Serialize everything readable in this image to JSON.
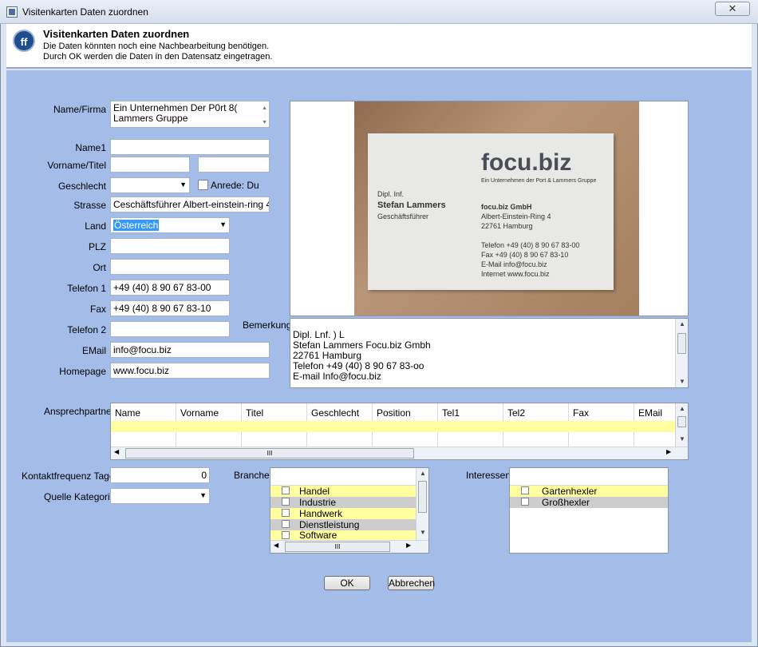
{
  "window": {
    "title": "Visitenkarten Daten zuordnen",
    "close": "✕"
  },
  "header": {
    "title": "Visitenkarten Daten zuordnen",
    "line1": "Die Daten könnten noch eine Nachbearbeitung benötigen.",
    "line2": "Durch OK werden die Daten in den Datensatz eingetragen.",
    "logo": "ff"
  },
  "form": {
    "name_firma_label": "Name/Firma",
    "name_firma_line1": "Ein Unternehmen Der P0rt 8(",
    "name_firma_line2": "Lammers Gruppe",
    "name1_label": "Name1",
    "name1": "",
    "vorname_titel_label": "Vorname/Titel",
    "vorname": "",
    "titel": "",
    "geschlecht_label": "Geschlecht",
    "geschlecht": "",
    "anrede_label": "Anrede: Du",
    "strasse_label": "Strasse",
    "strasse": "Ceschäftsführer Albert-einstein-ring 4",
    "land_label": "Land",
    "land": "Österreich",
    "plz_label": "PLZ",
    "plz": "",
    "ort_label": "Ort",
    "ort": "",
    "telefon1_label": "Telefon 1",
    "telefon1": "+49 (40) 8 90 67 83-00",
    "fax_label": "Fax",
    "fax": "+49 (40) 8 90 67 83-10",
    "telefon2_label": "Telefon 2",
    "telefon2": "",
    "email_label": "EMail",
    "email": "info@focu.biz",
    "homepage_label": "Homepage",
    "homepage": "www.focu.biz",
    "bemerkung_label": "Bemerkung",
    "bemerkung_lines": [
      "Dipl. Lnf. ) L",
      "Stefan Lammers Focu.biz Gmbh",
      "22761 Hamburg",
      "Telefon +49 (40) 8 90 67 83-oo",
      "E-mail Info@focu.biz"
    ]
  },
  "card": {
    "logo": "focu.biz",
    "tagline": "Ein Unternehmen der Port & Lammers Gruppe",
    "title": "Dipl. Inf.",
    "name": "Stefan Lammers",
    "role": "Geschäftsführer",
    "company": "focu.biz GmbH",
    "street": "Albert-Einstein-Ring 4",
    "city": "22761 Hamburg",
    "tel": "Telefon +49 (40) 8 90 67 83-00",
    "fax": "Fax +49 (40) 8 90 67 83-10",
    "email": "E-Mail info@focu.biz",
    "web": "Internet www.focu.biz"
  },
  "contacts": {
    "label": "Ansprechpartner",
    "columns": [
      "Name",
      "Vorname",
      "Titel",
      "Geschlecht",
      "Position",
      "Tel1",
      "Tel2",
      "Fax",
      "EMail"
    ],
    "hscroll": "III"
  },
  "kontakt": {
    "label": "Kontaktfrequenz Tage",
    "value": "0"
  },
  "quelle": {
    "label": "Quelle Kategorie",
    "value": ""
  },
  "branche": {
    "label": "Branche",
    "items": [
      "Handel",
      "Industrie",
      "Handwerk",
      "Dienstleistung",
      "Software"
    ],
    "hscroll": "III"
  },
  "interessen": {
    "label": "Interessen",
    "items": [
      "Gartenhexler",
      "Großhexler"
    ]
  },
  "buttons": {
    "ok": "OK",
    "cancel": "Abbrechen"
  }
}
